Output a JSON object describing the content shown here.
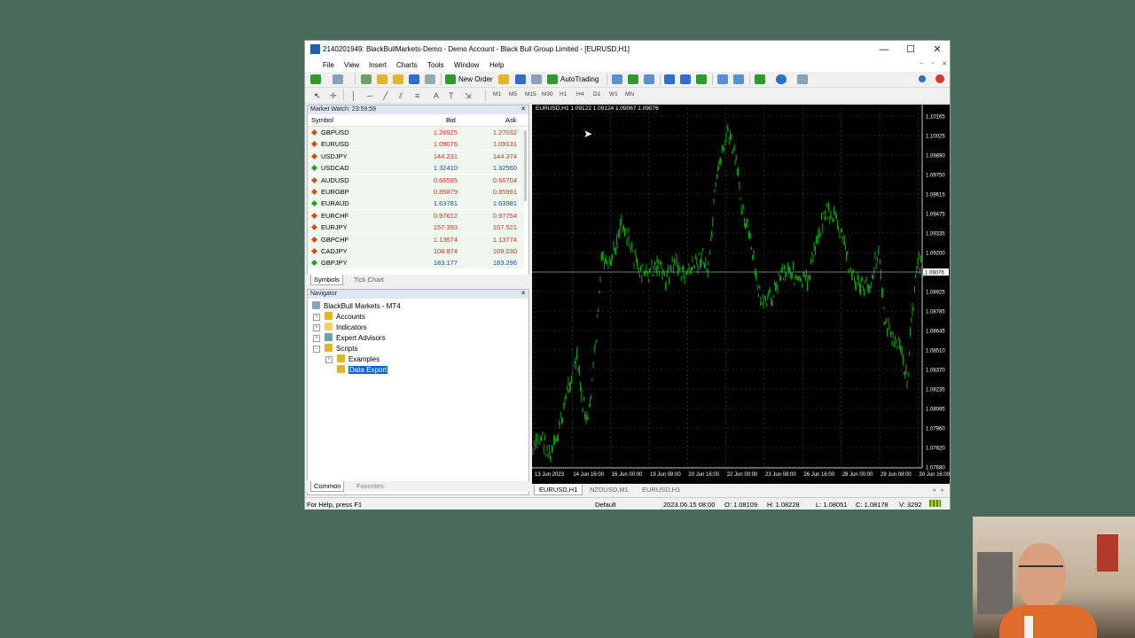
{
  "window": {
    "title": "2140201949: BlackBullMarkets-Demo - Demo Account - Black Bull Group Limited - [EURUSD,H1]",
    "controls": {
      "minimize": "—",
      "maximize": "☐",
      "close": "✕"
    }
  },
  "menu": {
    "items": [
      "File",
      "View",
      "Insert",
      "Charts",
      "Tools",
      "Window",
      "Help"
    ]
  },
  "toolbar": {
    "new_order": "New Order",
    "auto_trading": "AutoTrading",
    "timeframes": [
      "M1",
      "M5",
      "M15",
      "M30",
      "H1",
      "H4",
      "D1",
      "W1",
      "MN"
    ],
    "colors": {
      "green_icon": "#2e9b2e",
      "blue_icon": "#2f6fc9",
      "yellow_icon": "#e3b52a",
      "red_icon": "#d23a2a"
    }
  },
  "market_watch": {
    "title": "Market Watch: 23:59:59",
    "col_symbol": "Symbol",
    "col_bid": "Bid",
    "col_ask": "Ask",
    "rows": [
      {
        "symbol": "GBPUSD",
        "bid": "1.26925",
        "ask": "1.27032",
        "dir": "down"
      },
      {
        "symbol": "EURUSD",
        "bid": "1.09076",
        "ask": "1.09131",
        "dir": "down"
      },
      {
        "symbol": "USDJPY",
        "bid": "144.231",
        "ask": "144.374",
        "dir": "down"
      },
      {
        "symbol": "USDCAD",
        "bid": "1.32410",
        "ask": "1.32560",
        "dir": "up"
      },
      {
        "symbol": "AUDUSD",
        "bid": "0.66595",
        "ask": "0.66704",
        "dir": "down"
      },
      {
        "symbol": "EURGBP",
        "bid": "0.85879",
        "ask": "0.85961",
        "dir": "down"
      },
      {
        "symbol": "EURAUD",
        "bid": "1.63781",
        "ask": "1.63981",
        "dir": "up"
      },
      {
        "symbol": "EURCHF",
        "bid": "0.97612",
        "ask": "0.97754",
        "dir": "down"
      },
      {
        "symbol": "EURJPY",
        "bid": "157.393",
        "ask": "157.521",
        "dir": "down"
      },
      {
        "symbol": "GBPCHF",
        "bid": "1.13574",
        "ask": "1.13774",
        "dir": "down"
      },
      {
        "symbol": "CADJPY",
        "bid": "108.874",
        "ask": "109.030",
        "dir": "down"
      },
      {
        "symbol": "GBPJPY",
        "bid": "183.177",
        "ask": "183.296",
        "dir": "up"
      }
    ],
    "tabs": [
      "Symbols",
      "Tick Chart"
    ]
  },
  "navigator": {
    "title": "Navigator",
    "root": "BlackBull Markets - MT4",
    "items": [
      "Accounts",
      "Indicators",
      "Expert Advisors",
      "Scripts"
    ],
    "scripts_children": [
      "Examples",
      "Data Export"
    ],
    "tabs": [
      "Common",
      "Favorites"
    ]
  },
  "chart": {
    "header": "EURUSD,H1  1.09122 1.09124 1.09067 1.09076",
    "price_labels": [
      "1.10165",
      "1.10025",
      "1.09890",
      "1.09750",
      "1.09615",
      "1.09475",
      "1.09335",
      "1.09200",
      "1.09076",
      "1.08925",
      "1.08785",
      "1.08645",
      "1.08510",
      "1.08370",
      "1.08235",
      "1.08095",
      "1.07960",
      "1.07820",
      "1.07680"
    ],
    "current_price": "1.09076",
    "time_labels": [
      "13 Jun 2023",
      "14 Jun 16:00",
      "16 Jun 00:00",
      "19 Jun 08:00",
      "20 Jun 16:00",
      "22 Jun 00:00",
      "23 Jun 08:00",
      "26 Jun 16:00",
      "28 Jun 00:00",
      "29 Jun 08:00",
      "30 Jun 16:00"
    ],
    "tabs": [
      "EURUSD,H1",
      "NZDUSD,M1",
      "EURUSD,H1"
    ],
    "colors": {
      "background": "#000000",
      "bars": "#00c000",
      "grid": "#4a4a4a",
      "axis_text": "#ffffff"
    }
  },
  "status": {
    "help": "For Help, press F1",
    "profile": "Default",
    "datetime": "2023.06.15 08:00",
    "open": "O: 1.08109",
    "high": "H: 1.08228",
    "low": "L: 1.08051",
    "close": "C: 1.08178",
    "volume": "V: 3292"
  }
}
